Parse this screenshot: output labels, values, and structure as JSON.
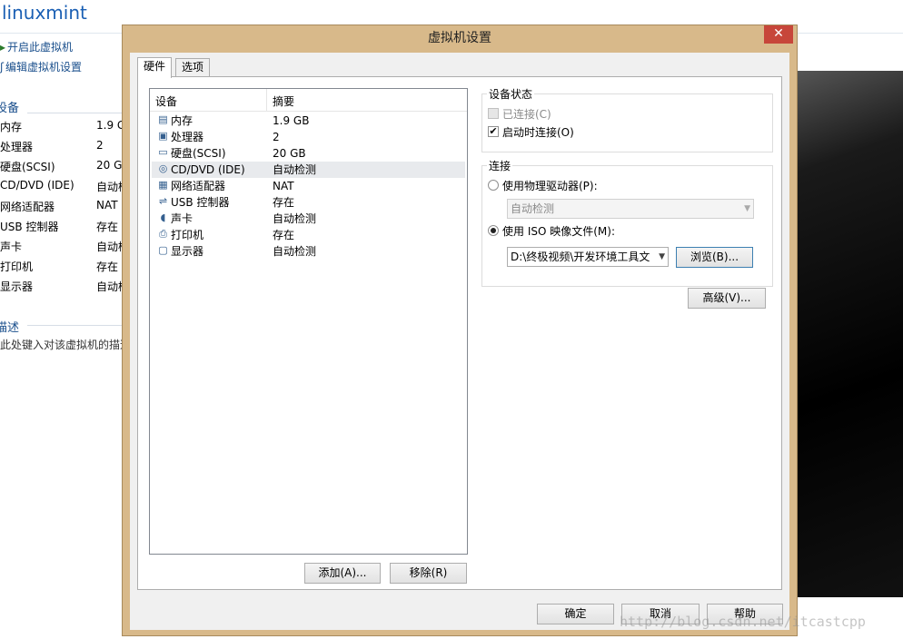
{
  "background": {
    "vm_name": "linuxmint",
    "actions": [
      "开启此虚拟机",
      "编辑虚拟机设置"
    ],
    "devices_section": "设备",
    "devices": [
      {
        "name": "内存",
        "value": "1.9 G"
      },
      {
        "name": "处理器",
        "value": "2"
      },
      {
        "name": "硬盘(SCSI)",
        "value": "20 G"
      },
      {
        "name": "CD/DVD (IDE)",
        "value": "自动检"
      },
      {
        "name": "网络适配器",
        "value": "NAT"
      },
      {
        "name": "USB 控制器",
        "value": "存在"
      },
      {
        "name": "声卡",
        "value": "自动检"
      },
      {
        "name": "打印机",
        "value": "存在"
      },
      {
        "name": "显示器",
        "value": "自动检"
      }
    ],
    "description_section": "描述",
    "description_placeholder": "在此处键入对该虚拟机的描述"
  },
  "dialog": {
    "title": "虚拟机设置",
    "close_glyph": "✕",
    "tabs": [
      "硬件",
      "选项"
    ],
    "list_headers": {
      "device": "设备",
      "summary": "摘要"
    },
    "devices": [
      {
        "icon": "memory-icon",
        "glyph": "▤",
        "name": "内存",
        "summary": "1.9 GB"
      },
      {
        "icon": "processor-icon",
        "glyph": "▣",
        "name": "处理器",
        "summary": "2"
      },
      {
        "icon": "hard-disk-icon",
        "glyph": "▭",
        "name": "硬盘(SCSI)",
        "summary": "20 GB"
      },
      {
        "icon": "cd-dvd-icon",
        "glyph": "◎",
        "name": "CD/DVD (IDE)",
        "summary": "自动检测",
        "selected": true
      },
      {
        "icon": "network-adapter-icon",
        "glyph": "▦",
        "name": "网络适配器",
        "summary": "NAT"
      },
      {
        "icon": "usb-icon",
        "glyph": "⇌",
        "name": "USB 控制器",
        "summary": "存在"
      },
      {
        "icon": "sound-card-icon",
        "glyph": "◖",
        "name": "声卡",
        "summary": "自动检测"
      },
      {
        "icon": "printer-icon",
        "glyph": "⎙",
        "name": "打印机",
        "summary": "存在"
      },
      {
        "icon": "display-icon",
        "glyph": "▢",
        "name": "显示器",
        "summary": "自动检测"
      }
    ],
    "add_button": "添加(A)...",
    "remove_button": "移除(R)",
    "device_status": {
      "title": "设备状态",
      "connected": {
        "label": "已连接(C)",
        "checked": false,
        "disabled": true
      },
      "connect_at_power_on": {
        "label": "启动时连接(O)",
        "checked": true
      }
    },
    "connection": {
      "title": "连接",
      "physical_drive": {
        "label": "使用物理驱动器(P):",
        "selected": false,
        "value": "自动检测"
      },
      "iso_image": {
        "label": "使用 ISO 映像文件(M):",
        "selected": true,
        "value": "D:\\终极视频\\开发环境工具文"
      },
      "browse_button": "浏览(B)..."
    },
    "advanced_button": "高级(V)...",
    "ok_button": "确定",
    "cancel_button": "取消",
    "help_button": "帮助"
  },
  "watermark": "http://blog.csdn.net/itcastcpp"
}
